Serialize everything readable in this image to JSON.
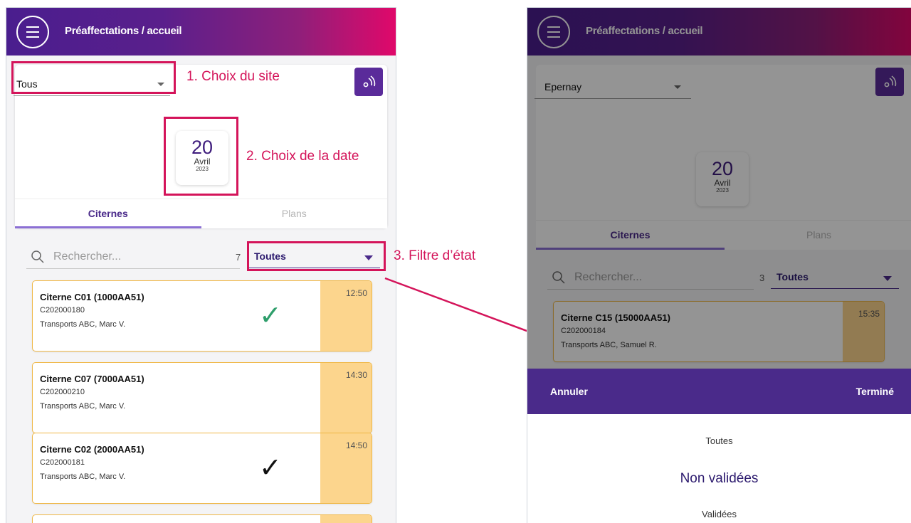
{
  "left": {
    "header": {
      "title": "Préaffectations / accueil"
    },
    "site_select": {
      "value": "Tous"
    },
    "date": {
      "day": "20",
      "month": "Avril",
      "year": "2023"
    },
    "tabs": [
      {
        "label": "Citernes",
        "active": true
      },
      {
        "label": "Plans",
        "active": false
      }
    ],
    "search": {
      "placeholder": "Rechercher..."
    },
    "count": "7",
    "filter": {
      "value": "Toutes"
    },
    "items": [
      {
        "title": "Citerne C01 (1000AA51)",
        "code": "C202000180",
        "sub": "Transports ABC, Marc V.",
        "time": "12:50",
        "status": "validated-green"
      },
      {
        "title": "Citerne C07 (7000AA51)",
        "code": "C202000210",
        "sub": "Transports ABC, Marc V.",
        "time": "14:30",
        "status": "none"
      },
      {
        "title": "Citerne C02 (2000AA51)",
        "code": "C202000181",
        "sub": "Transports ABC, Marc V.",
        "time": "14:50",
        "status": "validated-black"
      }
    ]
  },
  "annotations": {
    "site": "1. Choix du site",
    "date": "2. Choix de la date",
    "filter": "3. Filtre d’état"
  },
  "right": {
    "header": {
      "title": "Préaffectations / accueil"
    },
    "site_select": {
      "value": "Epernay"
    },
    "date": {
      "day": "20",
      "month": "Avril",
      "year": "2023"
    },
    "tabs": [
      {
        "label": "Citernes",
        "active": true
      },
      {
        "label": "Plans",
        "active": false
      }
    ],
    "search": {
      "placeholder": "Rechercher..."
    },
    "count": "3",
    "filter": {
      "value": "Toutes"
    },
    "item": {
      "title": "Citerne C15 (15000AA51)",
      "code": "C202000184",
      "sub": "Transports ABC, Samuel R.",
      "time": "15:35"
    },
    "sheet": {
      "cancel": "Annuler",
      "done": "Terminé",
      "options": [
        {
          "label": "Toutes",
          "selected": false
        },
        {
          "label": "Non validées",
          "selected": true
        },
        {
          "label": "Validées",
          "selected": false
        }
      ]
    }
  },
  "colors": {
    "accent": "#4a2a8a",
    "annotation": "#d4145a",
    "card_border": "#f0b847",
    "time_column": "#fcd58d",
    "check_green": "#2e9e6b"
  },
  "icons": [
    "menu-icon",
    "rss-icon",
    "search-icon",
    "chevron-down-icon",
    "check-icon"
  ]
}
